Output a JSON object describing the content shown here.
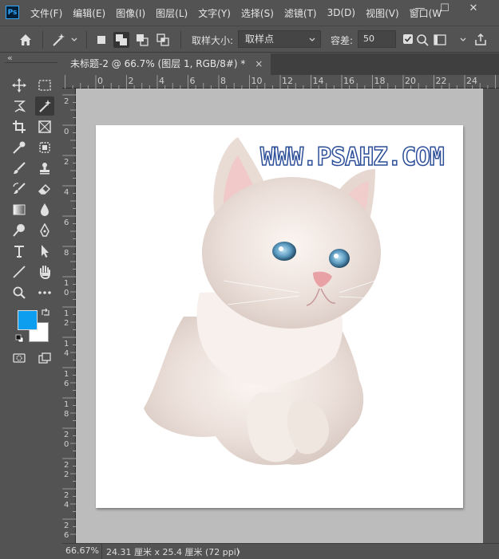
{
  "app": {
    "logo": "Ps"
  },
  "menu": [
    "文件(F)",
    "编辑(E)",
    "图像(I)",
    "图层(L)",
    "文字(Y)",
    "选择(S)",
    "滤镜(T)",
    "3D(D)",
    "视图(V)",
    "窗口(W"
  ],
  "window_controls": {
    "minimize": "—",
    "maximize": "☐",
    "close": "✕"
  },
  "options": {
    "sample_size_label": "取样大小:",
    "sample_size_value": "取样点",
    "tolerance_label": "容差:",
    "tolerance_value": "50"
  },
  "panel_collapse": "«",
  "document_tab": {
    "title": "未标题-2 @ 66.7% (图层 1, RGB/8#) *",
    "close": "×"
  },
  "ruler_top": [
    "0",
    "2",
    "4",
    "6",
    "8",
    "10",
    "12",
    "14",
    "16",
    "18",
    "20",
    "22",
    "24"
  ],
  "ruler_left": [
    "2",
    "0",
    "2",
    "4",
    "6",
    "8",
    "1\n0",
    "1\n2",
    "1\n4",
    "1\n6",
    "1\n8",
    "2\n0",
    "2\n2",
    "2\n4",
    "2\n6"
  ],
  "watermark": "WWW.PSAHZ.COM",
  "colors": {
    "foreground": "#0e9ef0",
    "background": "#ffffff",
    "accent": "#31a8ff"
  },
  "status": {
    "zoom": "66.67%",
    "doc_info": "24.31 厘米 x 25.4 厘米 (72 ppi)",
    "arrow": "〉"
  }
}
